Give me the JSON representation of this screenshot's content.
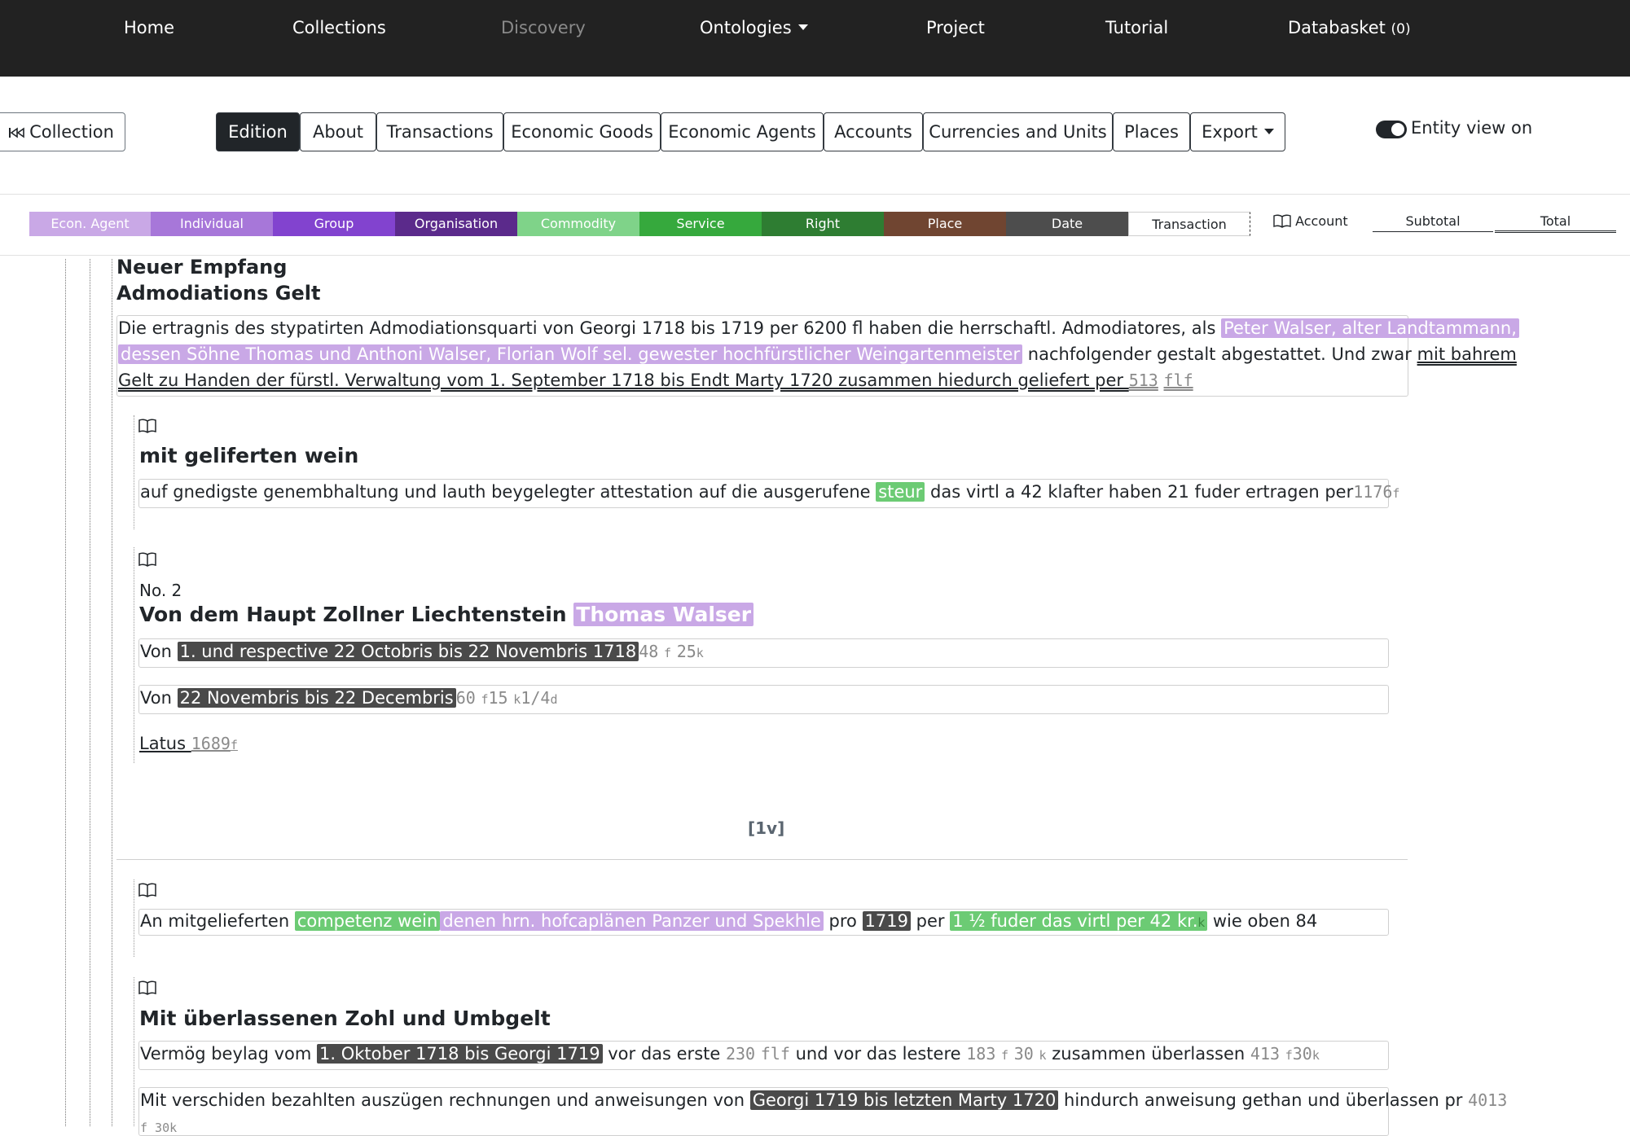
{
  "nav": {
    "home": "Home",
    "collections": "Collections",
    "discovery": "Discovery",
    "ontologies": "Ontologies",
    "project": "Project",
    "tutorial": "Tutorial",
    "databasket": "Databasket",
    "databasket_count": "(0)"
  },
  "toolbar": {
    "collection": "Collection",
    "tabs": {
      "edition": "Edition",
      "about": "About",
      "transactions": "Transactions",
      "economic_goods": "Economic Goods",
      "economic_agents": "Economic Agents",
      "accounts": "Accounts",
      "currencies": "Currencies and Units",
      "places": "Places",
      "export": "Export"
    },
    "entity_view": "Entity view on"
  },
  "legend": {
    "econ_agent": "Econ. Agent",
    "individual": "Individual",
    "group": "Group",
    "organisation": "Organisation",
    "commodity": "Commodity",
    "service": "Service",
    "right": "Right",
    "place": "Place",
    "date": "Date",
    "transaction": "Transaction",
    "account": "Account",
    "subtotal": "Subtotal",
    "total": "Total",
    "colors": {
      "econ_agent": "#c9a8e6",
      "individual": "#a777d9",
      "group": "#8243cf",
      "organisation": "#5b2a8b",
      "commodity": "#7fd389",
      "service": "#36a93d",
      "right": "#2e7d32",
      "place": "#704531",
      "date": "#4d4d4d"
    }
  },
  "content": {
    "heading1": "Neuer Empfang",
    "heading2": "Admodiations Gelt",
    "p1": {
      "a": "Die ertragnis des stypatirten Admodiationsquarti von Georgi 1718 bis 1719 per 6200 fl haben die herrschaftl. Admodiatores, als ",
      "agent1": "Peter Walser, alter Landtammann,",
      "agent2": "dessen Söhne Thomas und Anthoni Walser, Florian Wolf sel. gewester hochfürstlicher Weingartenmeister",
      "b": " nachfolgender gestalt abgestattet. Und zwar ",
      "u1": "mit bahrem",
      "u2": "Gelt zu Handen der fürstl. Verwaltung vom 1. September 1718 bis Endt Marty 1720 zusammen hiedurch geliefert per ",
      "amount": "513",
      "unit": "flf"
    },
    "b1": {
      "heading": "mit geliferten wein",
      "a": "auf gnedigste genembhaltung und lauth beygelegter attestation auf die ausgerufene ",
      "commodity": "steur",
      "b": " das virtl a 42 klafter haben 21 fuder ertragen per",
      "amount": "1176",
      "unit": "f"
    },
    "b2": {
      "no": "No. 2",
      "heading": "Von dem Haupt Zollner Liechtenstein ",
      "agent": "Thomas Walser",
      "r1_von": "Von ",
      "r1_date": "1. und respective 22 Octobris bis 22 Novembris 1718",
      "r1_v1": "48",
      "r1_u1": "f",
      "r1_v2": "25",
      "r1_u2": "k",
      "r2_von": "Von ",
      "r2_date": "22 Novembris bis 22 Decembris",
      "r2_v1": "60",
      "r2_u1": "f",
      "r2_v2": "15",
      "r2_u2": "k",
      "r2_v3": "1/4",
      "r2_u3": "d",
      "latus": "Latus ",
      "latus_amount": "1689",
      "latus_unit": "f"
    },
    "page": "[1v]",
    "b3": {
      "a": "An mitgelieferten ",
      "commodity": "competenz wein",
      "agent": "denen hrn. hofcaplänen Panzer und Spekhle",
      "b": " pro ",
      "date": "1719",
      "c": " per ",
      "commodity2": "1 ½ fuder das virtl per 42 kr.",
      "k": "k",
      "d": " wie oben 84"
    },
    "b4": {
      "heading": "Mit überlassenen Zohl und Umbgelt",
      "r1_a": "Vermög beylag vom ",
      "r1_date": "1. Oktober 1718 bis Georgi 1719",
      "r1_b": " vor das erste ",
      "r1_v1": "230",
      "r1_u1": "flf",
      "r1_c": " und vor das lestere ",
      "r1_v2": "183",
      "r1_u2": "f",
      "r1_v3": "30",
      "r1_u3": "k",
      "r1_d": " zusammen überlassen ",
      "r1_v4": "413",
      "r1_u4": "f",
      "r1_v5": "30",
      "r1_u5": "k",
      "r2_a": "Mit verschiden bezahlten auszügen rechnungen und anweisungen von ",
      "r2_date": "Georgi 1719 bis letzten Marty 1720",
      "r2_b": " hindurch anweisung gethan und überlassen pr ",
      "r2_v1": "4013",
      "r2_v2": "f 30k"
    }
  }
}
